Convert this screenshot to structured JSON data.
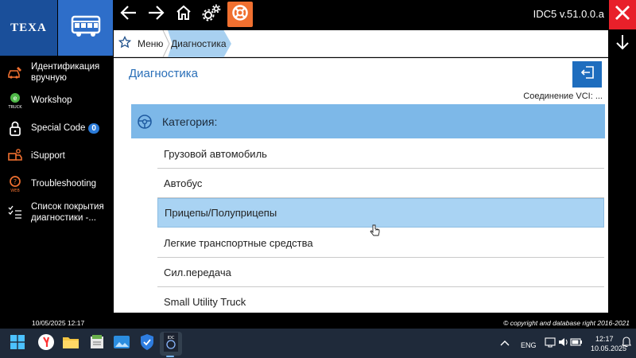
{
  "header": {
    "brand": "TEXA",
    "version": "IDC5 v.51.0.0.a"
  },
  "breadcrumb": {
    "items": [
      "Меню",
      "Диагностика"
    ]
  },
  "main": {
    "title": "Диагностика",
    "vci_status": "Соединение VCI: ...",
    "category_header": "Категория:",
    "items": [
      {
        "label": "Грузовой автомобиль",
        "selected": false
      },
      {
        "label": "Автобус",
        "selected": false
      },
      {
        "label": "Прицепы/Полуприцепы",
        "selected": true
      },
      {
        "label": "Легкие транспортные средства",
        "selected": false
      },
      {
        "label": "Сил.передача",
        "selected": false
      },
      {
        "label": "Small Utility Truck",
        "selected": false
      }
    ]
  },
  "sidebar": {
    "items": [
      {
        "label_line1": "Идентификация",
        "label_line2": "вручную",
        "icon": "car-wrench-icon"
      },
      {
        "label_line1": "Workshop",
        "label_line2": "",
        "icon": "truck-workshop-icon"
      },
      {
        "label_line1": "Special Code",
        "label_line2": "",
        "icon": "lock-icon",
        "badge": "0"
      },
      {
        "label_line1": "iSupport",
        "label_line2": "",
        "icon": "support-icon"
      },
      {
        "label_line1": "Troubleshooting",
        "label_line2": "",
        "icon": "troubleshooting-web-icon"
      },
      {
        "label_line1": "Список покрытия",
        "label_line2": "диагностики -...",
        "icon": "coverage-list-icon"
      }
    ]
  },
  "footer": {
    "datetime": "10/05/2025 12:17",
    "copyright": "© copyright and database right 2016-2021"
  },
  "taskbar": {
    "language": "ENG",
    "time": "12:17",
    "date": "10.05.2025"
  },
  "colors": {
    "brand_blue": "#1a4f9a",
    "accent_blue": "#2e6ec9",
    "selected_row": "#a9d3f3",
    "category_header": "#7db8e8",
    "close_red": "#e8202a",
    "support_orange": "#f07030"
  }
}
